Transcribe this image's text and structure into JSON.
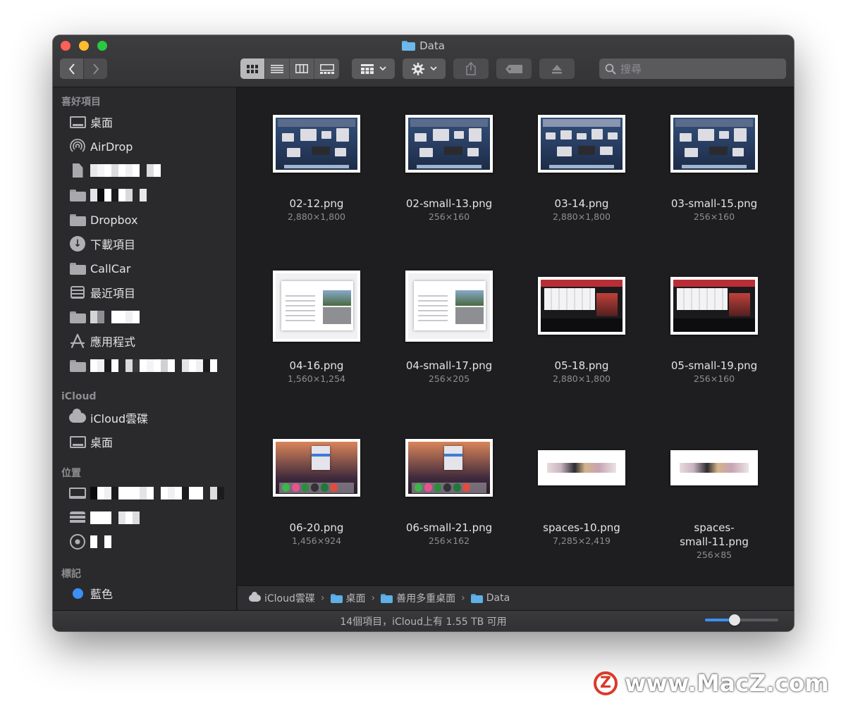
{
  "window": {
    "title": "Data"
  },
  "toolbar": {
    "back_icon": "chevron-left-icon",
    "forward_icon": "chevron-right-icon",
    "view_modes": [
      "icon-view",
      "list-view",
      "column-view",
      "gallery-view"
    ],
    "active_view": "icon-view",
    "search_placeholder": "搜尋"
  },
  "sidebar": {
    "favorites_header": "喜好項目",
    "favorites": [
      {
        "label": "桌面",
        "icon": "desktop-icon"
      },
      {
        "label": "AirDrop",
        "icon": "airdrop-icon"
      },
      {
        "label": "",
        "icon": "document-icon"
      },
      {
        "label": "",
        "icon": "folder-icon"
      },
      {
        "label": "Dropbox",
        "icon": "folder-icon"
      },
      {
        "label": "下載項目",
        "icon": "downloads-icon"
      },
      {
        "label": "CallCar",
        "icon": "folder-icon"
      },
      {
        "label": "最近項目",
        "icon": "recents-icon"
      },
      {
        "label": "",
        "icon": "folder-icon"
      },
      {
        "label": "應用程式",
        "icon": "applications-icon"
      },
      {
        "label": "",
        "icon": "folder-icon"
      }
    ],
    "icloud_header": "iCloud",
    "icloud": [
      {
        "label": "iCloud雲碟",
        "icon": "cloud-icon"
      },
      {
        "label": "桌面",
        "icon": "desktop-icon"
      }
    ],
    "locations_header": "位置",
    "locations": [
      {
        "label": "",
        "icon": "laptop-icon"
      },
      {
        "label": "",
        "icon": "drive-icon"
      },
      {
        "label": "",
        "icon": "network-icon"
      }
    ],
    "tags_header": "標記",
    "tags": [
      {
        "label": "藍色",
        "color": "#3b8ff6"
      }
    ]
  },
  "files": [
    {
      "name": "02-12.png",
      "dims": "2,880×1,800",
      "kind": "desk-blue"
    },
    {
      "name": "02-small-13.png",
      "dims": "256×160",
      "kind": "desk-blue"
    },
    {
      "name": "03-14.png",
      "dims": "2,880×1,800",
      "kind": "desk-blue"
    },
    {
      "name": "03-small-15.png",
      "dims": "256×160",
      "kind": "desk-blue"
    },
    {
      "name": "04-16.png",
      "dims": "1,560×1,254",
      "kind": "sysprefs"
    },
    {
      "name": "04-small-17.png",
      "dims": "256×205",
      "kind": "sysprefs"
    },
    {
      "name": "05-18.png",
      "dims": "2,880×1,800",
      "kind": "webshot"
    },
    {
      "name": "05-small-19.png",
      "dims": "256×160",
      "kind": "webshot"
    },
    {
      "name": "06-20.png",
      "dims": "1,456×924",
      "kind": "sierra"
    },
    {
      "name": "06-small-21.png",
      "dims": "256×162",
      "kind": "sierra"
    },
    {
      "name": "spaces-10.png",
      "dims": "7,285×2,419",
      "kind": "spaces"
    },
    {
      "name": "spaces-small-11.png",
      "name_line1": "spaces-",
      "name_line2": "small-11.png",
      "dims": "256×85",
      "kind": "spaces"
    }
  ],
  "pathbar": [
    "iCloud雲碟",
    "桌面",
    "善用多重桌面",
    "Data"
  ],
  "status": {
    "text": "14個項目，iCloud上有 1.55 TB 可用",
    "icon_size_level": 0.4
  },
  "watermark": {
    "logo_letter": "Z",
    "text": "www.MacZ.com"
  },
  "colors": {
    "accent": "#3b8ff6",
    "close": "#fe5f57",
    "minimize": "#febc2e",
    "zoom": "#29c840"
  }
}
